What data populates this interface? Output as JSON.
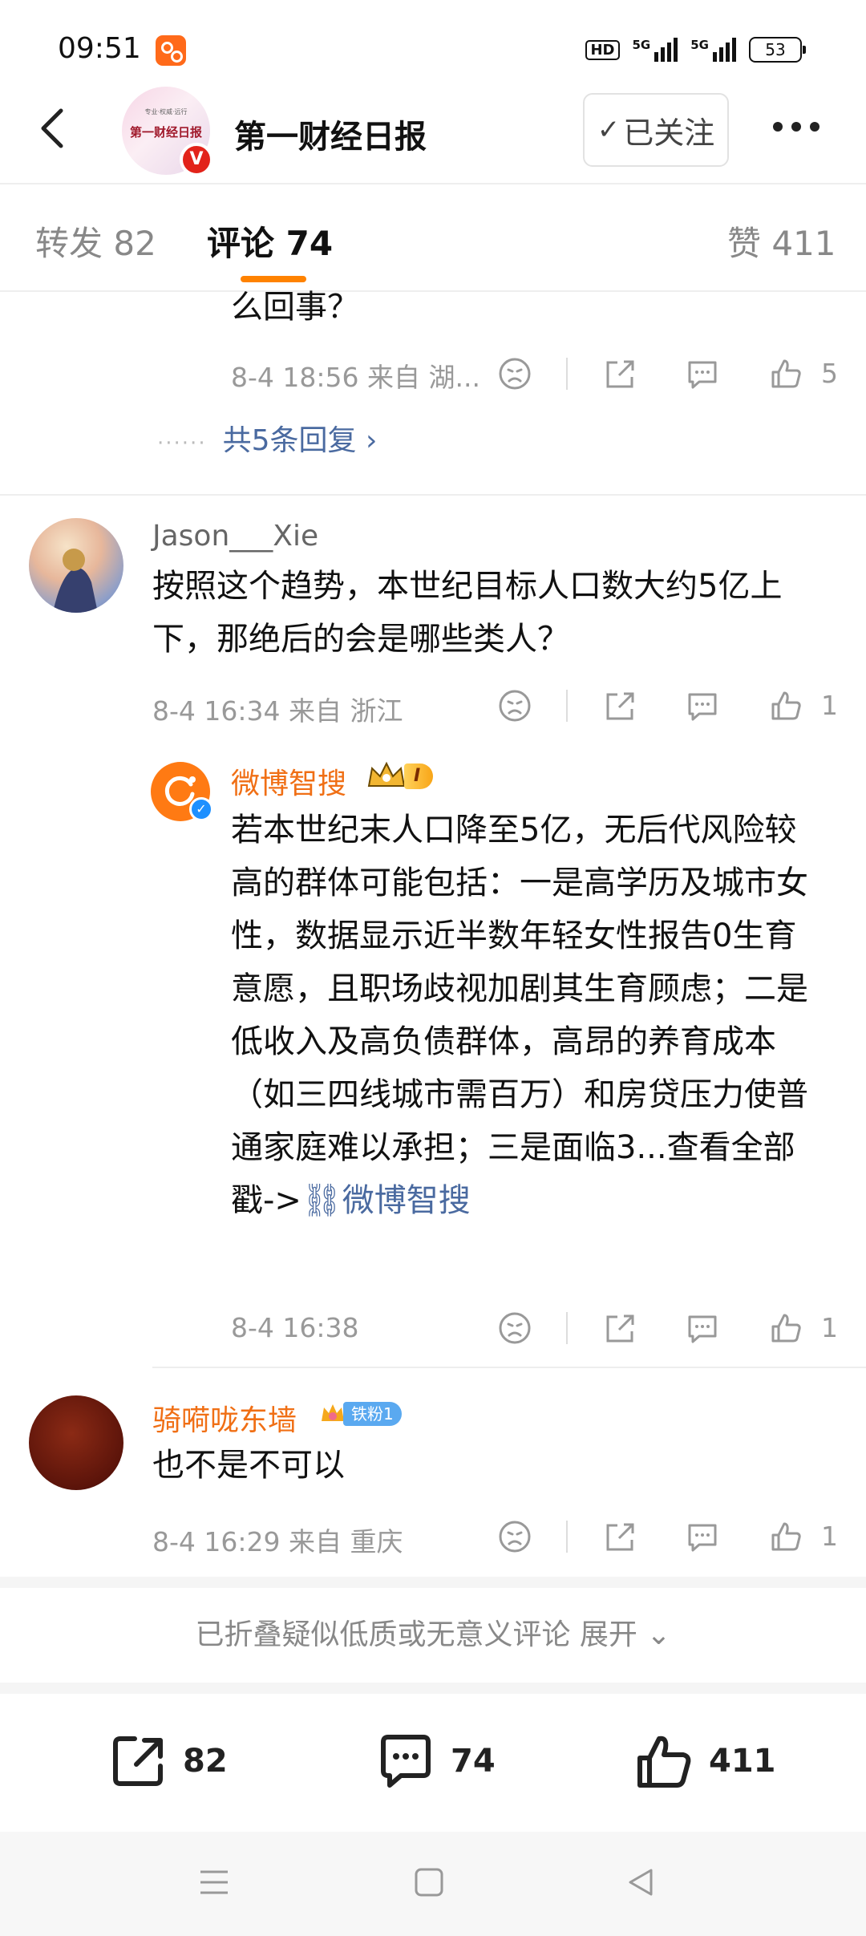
{
  "status": {
    "time": "09:51",
    "hd": "HD",
    "net1": "5G",
    "net2": "5G",
    "battery": "53"
  },
  "header": {
    "title": "第一财经日报",
    "avatar_text": "第一财经日报",
    "avatar_sub": "专业·权威·远行",
    "avatar_badge": "V",
    "follow_label": "已关注"
  },
  "tabs": {
    "repost": "转发 82",
    "comment": "评论 74",
    "like": "赞 411"
  },
  "comments": [
    {
      "text_tail": "么回事？",
      "meta": "8-4 18:56  来自 湖...",
      "likes": "5",
      "replies_link": "共5条回复 ›"
    },
    {
      "user": "Jason___Xie",
      "text": "按照这个趋势，本世纪目标人口数大约5亿上下，那绝后的会是哪些类人？",
      "meta": "8-4 16:34  来自 浙江",
      "likes": "1",
      "reply": {
        "user": "微博智搜",
        "level": "I",
        "text": "若本世纪末人口降至5亿，无后代风险较高的群体可能包括：一是高学历及城市女性，数据显示近半数年轻女性报告0生育意愿，且职场歧视加剧其生育顾虑；二是低收入及高负债群体，高昂的养育成本（如三四线城市需百万）和房贷压力使普通家庭难以承担；三是面临3...查看全部戳->",
        "link": "微博智搜",
        "meta": "8-4 16:38",
        "likes": "1"
      }
    },
    {
      "user": "骑嗬咙东墙",
      "fan_badge": "铁粉1",
      "text": "也不是不可以",
      "meta": "8-4 16:29  来自 重庆",
      "likes": "1"
    }
  ],
  "fold_text": "已折叠疑似低质或无意义评论 展开 ⌄",
  "bottom": {
    "repost": "82",
    "comment": "74",
    "like": "411"
  },
  "colors": {
    "accent": "#ff8200",
    "name_orange": "#f06f15",
    "link_blue": "#4a6aa0"
  }
}
